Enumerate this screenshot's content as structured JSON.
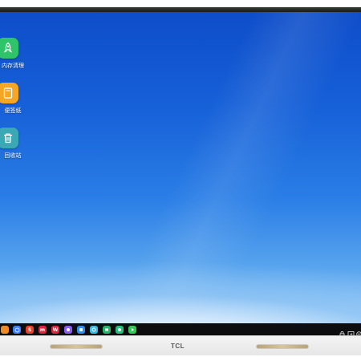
{
  "desktop": {
    "icons": [
      {
        "label": "内存清理",
        "icon": "rocket-icon",
        "color": "#2fc46a"
      },
      {
        "label": "便签纸",
        "icon": "notepad-icon",
        "color": "#f5a623"
      },
      {
        "label": "回收站",
        "icon": "trash-icon",
        "color": "#3aa9b5"
      }
    ]
  },
  "taskbar": {
    "apps": [
      {
        "icon": "home-icon",
        "color": "#f08a24",
        "text": ""
      },
      {
        "icon": "browser-icon",
        "color": "#3b82f6",
        "text": ""
      },
      {
        "icon": "s-app-icon",
        "color": "#e8412c",
        "text": "S"
      },
      {
        "icon": "presentation-app-icon",
        "color": "#d9263c",
        "text": "m"
      },
      {
        "icon": "word-app-icon",
        "color": "#d9263c",
        "text": "W"
      },
      {
        "icon": "purple-app-icon",
        "color": "#8a5cf5",
        "text": ""
      },
      {
        "icon": "blue-app-icon",
        "color": "#2f8cf0",
        "text": ""
      },
      {
        "icon": "cyan-app-icon",
        "color": "#3bb7e8",
        "text": ""
      },
      {
        "icon": "green-app-icon",
        "color": "#26b36a",
        "text": ""
      },
      {
        "icon": "teal-app-icon",
        "color": "#22c07a",
        "text": ""
      },
      {
        "icon": "bright-green-app-icon",
        "color": "#2ecc55",
        "text": ""
      }
    ],
    "system": [
      "lock-icon",
      "input-icon",
      "settings-icon"
    ]
  },
  "device": {
    "brand": "TCL"
  }
}
